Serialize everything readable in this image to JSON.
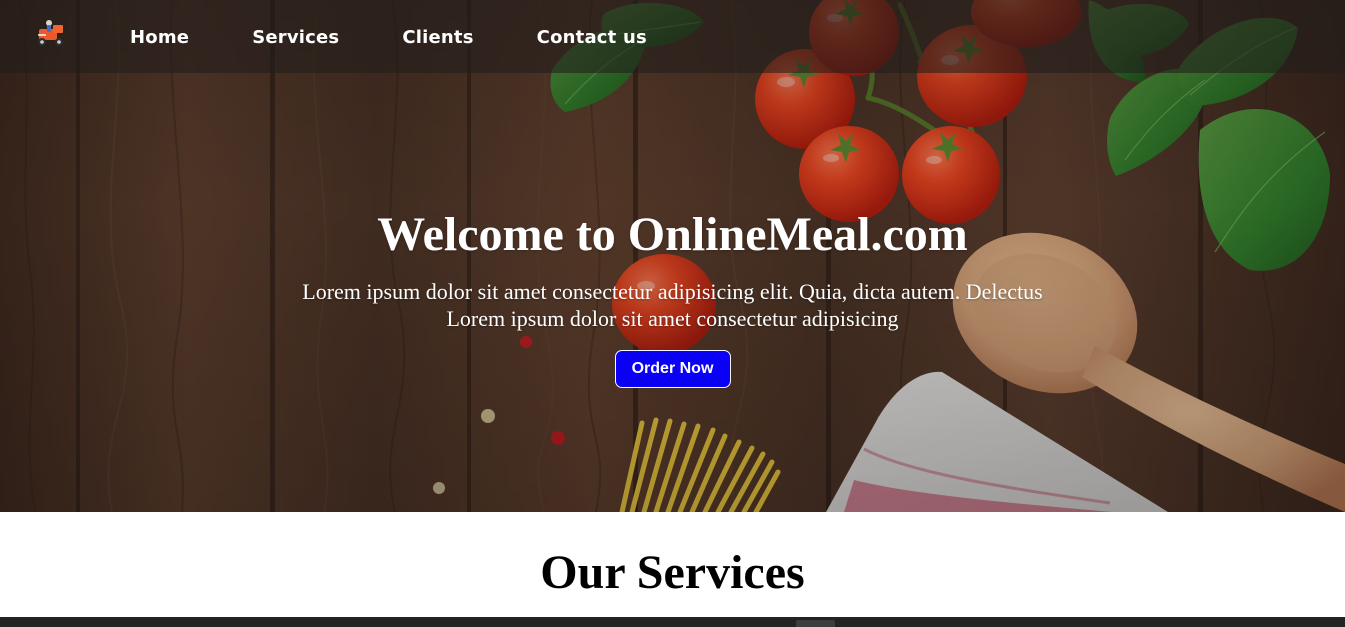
{
  "navbar": {
    "logo_icon": "delivery-scooter-icon",
    "links": [
      {
        "label": "Home"
      },
      {
        "label": "Services"
      },
      {
        "label": "Clients"
      },
      {
        "label": "Contact us"
      }
    ]
  },
  "hero": {
    "title": "Welcome to OnlineMeal.com",
    "description_lines": [
      "Lorem ipsum dolor sit amet consectetur adipisicing elit. Quia, dicta autem. Delectus",
      "Lorem ipsum dolor sit amet consectetur adipisicing"
    ],
    "cta_label": "Order Now",
    "background_image": "wooden-table-with-tomatoes-basil-pasta-spoon-and-towel"
  },
  "services": {
    "heading": "Our Services"
  },
  "colors": {
    "cta_background": "#0a00f5",
    "nav_background": "#231e1c",
    "section_strip": "#232323"
  }
}
